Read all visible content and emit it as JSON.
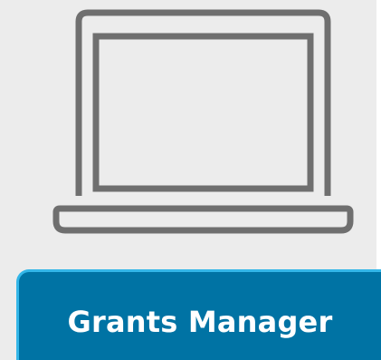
{
  "app_tile": {
    "icon": "laptop-icon",
    "label": "Grants Manager",
    "colors": {
      "background": "#ececec",
      "icon_stroke": "#6f6f6f",
      "button_fill": "#0073a4",
      "button_border": "#33b6e8",
      "button_text": "#ffffff"
    }
  }
}
